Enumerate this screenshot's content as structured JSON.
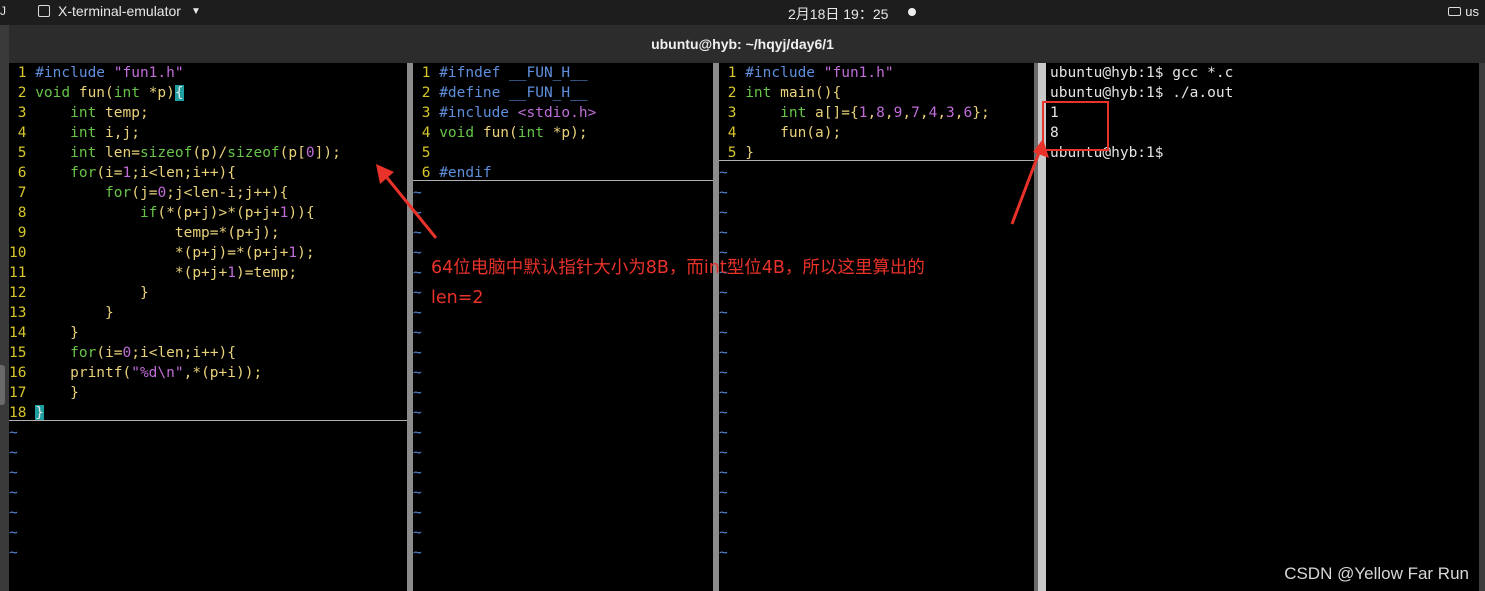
{
  "top_bar": {
    "left_glyph": "J",
    "app_name": "X-terminal-emulator",
    "clock": "2月18日  19：25",
    "keyboard_layout": "us"
  },
  "window": {
    "title": "ubuntu@hyb: ~/hqyj/day6/1"
  },
  "pane1": {
    "lines": [
      {
        "n": "1",
        "segs": [
          {
            "c": "pre",
            "t": "#include "
          },
          {
            "c": "str",
            "t": "\"fun1.h\""
          }
        ]
      },
      {
        "n": "2",
        "segs": [
          {
            "c": "kw",
            "t": "void"
          },
          {
            "c": "id",
            "t": " fun("
          },
          {
            "c": "kw",
            "t": "int"
          },
          {
            "c": "id",
            "t": " *p)"
          },
          {
            "c": "brk",
            "t": "{"
          }
        ]
      },
      {
        "n": "3",
        "segs": [
          {
            "c": "id",
            "t": "    "
          },
          {
            "c": "kw",
            "t": "int"
          },
          {
            "c": "id",
            "t": " temp;"
          }
        ]
      },
      {
        "n": "4",
        "segs": [
          {
            "c": "id",
            "t": "    "
          },
          {
            "c": "kw",
            "t": "int"
          },
          {
            "c": "id",
            "t": " i,j;"
          }
        ]
      },
      {
        "n": "5",
        "segs": [
          {
            "c": "id",
            "t": "    "
          },
          {
            "c": "kw",
            "t": "int"
          },
          {
            "c": "id",
            "t": " len="
          },
          {
            "c": "kw",
            "t": "sizeof"
          },
          {
            "c": "id",
            "t": "(p)/"
          },
          {
            "c": "kw",
            "t": "sizeof"
          },
          {
            "c": "id",
            "t": "(p["
          },
          {
            "c": "str",
            "t": "0"
          },
          {
            "c": "id",
            "t": "]);"
          }
        ]
      },
      {
        "n": "6",
        "segs": [
          {
            "c": "id",
            "t": "    "
          },
          {
            "c": "kw",
            "t": "for"
          },
          {
            "c": "id",
            "t": "(i="
          },
          {
            "c": "str",
            "t": "1"
          },
          {
            "c": "id",
            "t": ";i<len;i++){"
          }
        ]
      },
      {
        "n": "7",
        "segs": [
          {
            "c": "id",
            "t": "        "
          },
          {
            "c": "kw",
            "t": "for"
          },
          {
            "c": "id",
            "t": "(j="
          },
          {
            "c": "str",
            "t": "0"
          },
          {
            "c": "id",
            "t": ";j<len-i;j++){"
          }
        ]
      },
      {
        "n": "8",
        "segs": [
          {
            "c": "id",
            "t": "            "
          },
          {
            "c": "kw",
            "t": "if"
          },
          {
            "c": "id",
            "t": "(*(p+j)>*(p+j+"
          },
          {
            "c": "str",
            "t": "1"
          },
          {
            "c": "id",
            "t": ")){"
          }
        ]
      },
      {
        "n": "9",
        "segs": [
          {
            "c": "id",
            "t": "                temp=*(p+j);"
          }
        ]
      },
      {
        "n": "10",
        "segs": [
          {
            "c": "id",
            "t": "                *(p+j)=*(p+j+"
          },
          {
            "c": "str",
            "t": "1"
          },
          {
            "c": "id",
            "t": ");"
          }
        ]
      },
      {
        "n": "11",
        "segs": [
          {
            "c": "id",
            "t": "                *(p+j+"
          },
          {
            "c": "str",
            "t": "1"
          },
          {
            "c": "id",
            "t": ")=temp;"
          }
        ]
      },
      {
        "n": "12",
        "segs": [
          {
            "c": "id",
            "t": "            }"
          }
        ]
      },
      {
        "n": "13",
        "segs": [
          {
            "c": "id",
            "t": "        }"
          }
        ]
      },
      {
        "n": "14",
        "segs": [
          {
            "c": "id",
            "t": "    }"
          }
        ]
      },
      {
        "n": "15",
        "segs": [
          {
            "c": "id",
            "t": "    "
          },
          {
            "c": "kw",
            "t": "for"
          },
          {
            "c": "id",
            "t": "(i="
          },
          {
            "c": "str",
            "t": "0"
          },
          {
            "c": "id",
            "t": ";i<len;i++){"
          }
        ]
      },
      {
        "n": "16",
        "segs": [
          {
            "c": "id",
            "t": "    printf("
          },
          {
            "c": "str",
            "t": "\"%d\\n\""
          },
          {
            "c": "id",
            "t": ",*(p+i));"
          }
        ]
      },
      {
        "n": "17",
        "segs": [
          {
            "c": "id",
            "t": "    }"
          }
        ]
      },
      {
        "n": "18",
        "segs": [
          {
            "c": "brk",
            "t": "}"
          }
        ]
      }
    ]
  },
  "pane2": {
    "lines": [
      {
        "n": "1",
        "segs": [
          {
            "c": "pre",
            "t": "#ifndef __FUN_H__"
          }
        ]
      },
      {
        "n": "2",
        "segs": [
          {
            "c": "pre",
            "t": "#define __FUN_H__"
          }
        ]
      },
      {
        "n": "3",
        "segs": [
          {
            "c": "pre",
            "t": "#include "
          },
          {
            "c": "str",
            "t": "<stdio.h>"
          }
        ]
      },
      {
        "n": "4",
        "segs": [
          {
            "c": "kw",
            "t": "void"
          },
          {
            "c": "id",
            "t": " fun("
          },
          {
            "c": "kw",
            "t": "int"
          },
          {
            "c": "id",
            "t": " *p);"
          }
        ]
      },
      {
        "n": "5",
        "segs": []
      },
      {
        "n": "6",
        "segs": [
          {
            "c": "pre",
            "t": "#endif"
          }
        ]
      }
    ]
  },
  "pane3": {
    "lines": [
      {
        "n": "1",
        "segs": [
          {
            "c": "pre",
            "t": "#include "
          },
          {
            "c": "str",
            "t": "\"fun1.h\""
          }
        ]
      },
      {
        "n": "2",
        "segs": [
          {
            "c": "kw",
            "t": "int"
          },
          {
            "c": "id",
            "t": " main(){"
          }
        ]
      },
      {
        "n": "3",
        "segs": [
          {
            "c": "id",
            "t": "    "
          },
          {
            "c": "kw",
            "t": "int"
          },
          {
            "c": "id",
            "t": " a[]={"
          },
          {
            "c": "str",
            "t": "1"
          },
          {
            "c": "id",
            "t": ","
          },
          {
            "c": "str",
            "t": "8"
          },
          {
            "c": "id",
            "t": ","
          },
          {
            "c": "str",
            "t": "9"
          },
          {
            "c": "id",
            "t": ","
          },
          {
            "c": "str",
            "t": "7"
          },
          {
            "c": "id",
            "t": ","
          },
          {
            "c": "str",
            "t": "4"
          },
          {
            "c": "id",
            "t": ","
          },
          {
            "c": "str",
            "t": "3"
          },
          {
            "c": "id",
            "t": ","
          },
          {
            "c": "str",
            "t": "6"
          },
          {
            "c": "id",
            "t": "};"
          }
        ]
      },
      {
        "n": "4",
        "segs": [
          {
            "c": "id",
            "t": "    fun(a);"
          }
        ]
      },
      {
        "n": "5",
        "segs": [
          {
            "c": "id",
            "t": "}"
          }
        ]
      }
    ]
  },
  "terminal": {
    "lines": [
      "ubuntu@hyb:1$ gcc *.c",
      "ubuntu@hyb:1$ ./a.out",
      "1",
      "8",
      "ubuntu@hyb:1$"
    ]
  },
  "annotation": {
    "line1": "64位电脑中默认指针大小为8B，而int型位4B，所以这里算出的",
    "line2": "len=2",
    "color": "#e8322a"
  },
  "watermark": "CSDN @Yellow  Far  Run",
  "tilde": "~"
}
